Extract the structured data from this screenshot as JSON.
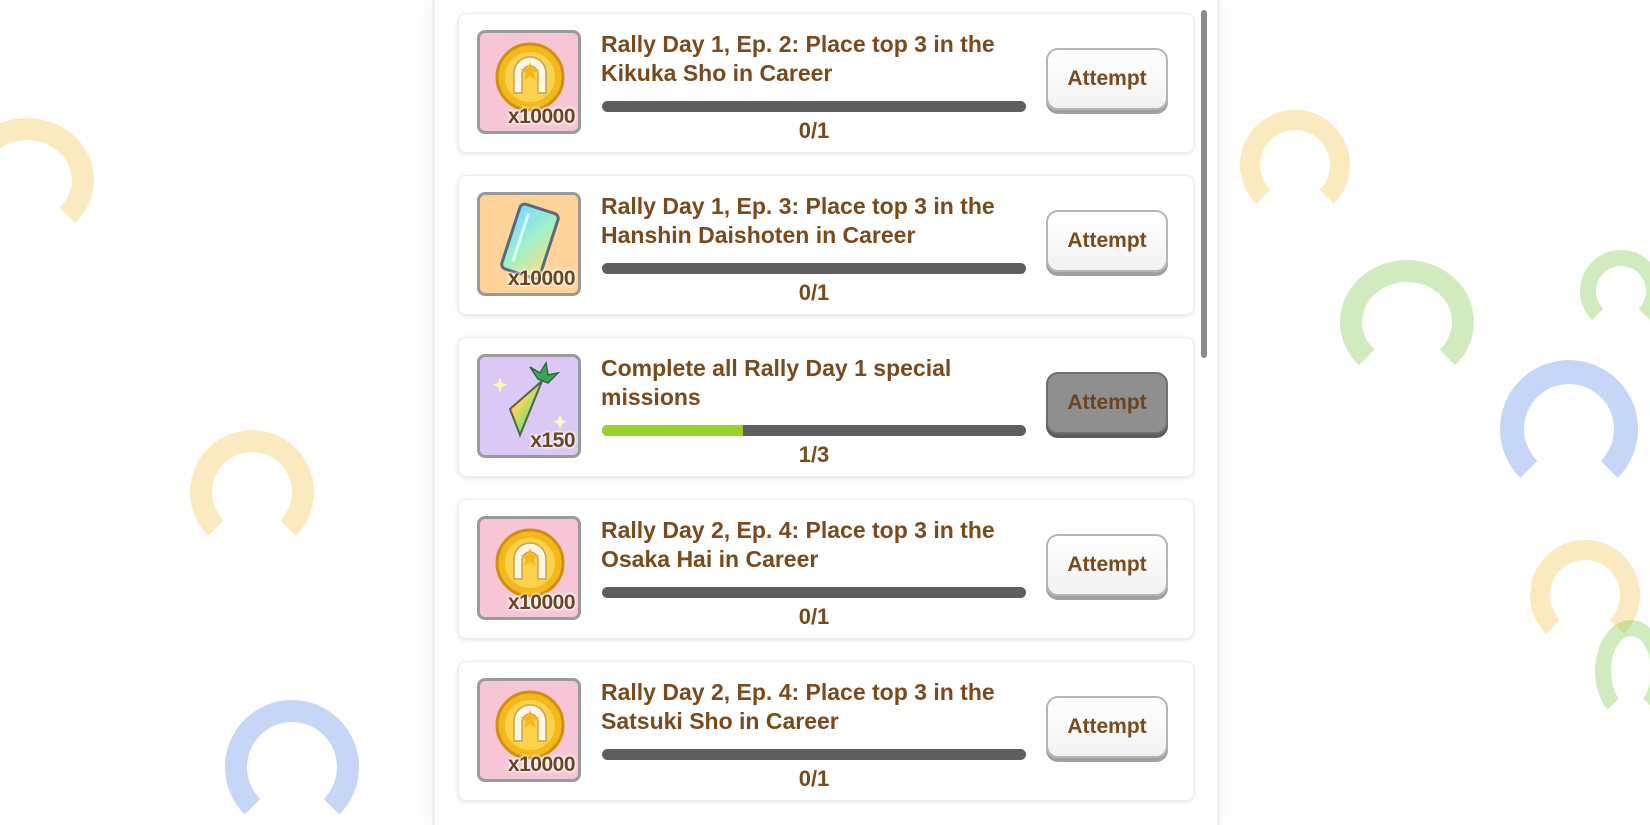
{
  "missions": [
    {
      "reward": {
        "icon": "horseshoe-coin-icon",
        "qty": "x10000",
        "bg": "#f7c6d6"
      },
      "title": "Rally Day 1, Ep. 2: Place top 3 in the Kikuka Sho in Career",
      "progress": "0/1",
      "fraction": 0,
      "button": "Attempt",
      "enabled": true
    },
    {
      "reward": {
        "icon": "rainbow-ticket-icon",
        "qty": "x10000",
        "bg": "#ffd39a"
      },
      "title": "Rally Day 1, Ep. 3: Place top 3 in the Hanshin Daishoten in Career",
      "progress": "0/1",
      "fraction": 0,
      "button": "Attempt",
      "enabled": true
    },
    {
      "reward": {
        "icon": "rainbow-carrot-icon",
        "qty": "x150",
        "bg": "#dcc8f5"
      },
      "title": "Complete all Rally Day 1 special missions",
      "progress": "1/3",
      "fraction": 0.333,
      "button": "Attempt",
      "enabled": false
    },
    {
      "reward": {
        "icon": "horseshoe-coin-icon",
        "qty": "x10000",
        "bg": "#f7c6d6"
      },
      "title": "Rally Day 2, Ep. 4: Place top 3 in the Osaka Hai in Career",
      "progress": "0/1",
      "fraction": 0,
      "button": "Attempt",
      "enabled": true
    },
    {
      "reward": {
        "icon": "horseshoe-coin-icon",
        "qty": "x10000",
        "bg": "#f7c6d6"
      },
      "title": "Rally Day 2, Ep. 4: Place top 3 in the Satsuki Sho in Career",
      "progress": "0/1",
      "fraction": 0,
      "button": "Attempt",
      "enabled": true
    }
  ],
  "colors": {
    "text_brown": "#7a4a1c",
    "progress_fill": "#9ad12a",
    "progress_track": "#5e5e5e",
    "disabled_button": "#8f8f8f"
  }
}
